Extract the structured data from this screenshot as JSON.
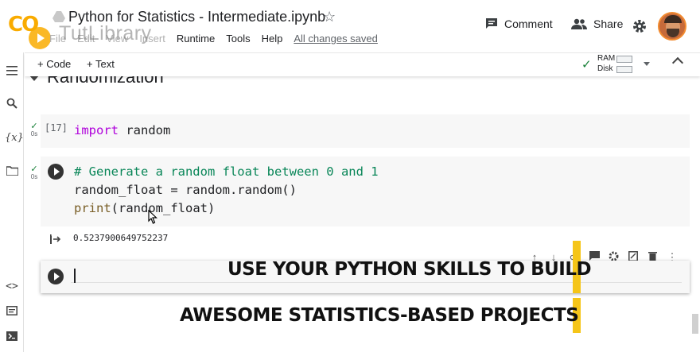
{
  "header": {
    "notebook_title": "Python for Statistics - Intermediate.ipynb",
    "watermark": "TutLibrary",
    "menu": [
      "File",
      "Edit",
      "View",
      "Insert",
      "Runtime",
      "Tools",
      "Help"
    ],
    "saved_status": "All changes saved",
    "comment_label": "Comment",
    "share_label": "Share"
  },
  "toolbar": {
    "add_code_label": "+ Code",
    "add_text_label": "+ Text",
    "ram_label": "RAM",
    "disk_label": "Disk"
  },
  "section": {
    "heading": "Randomization"
  },
  "cells": [
    {
      "exec_count": "[17]",
      "status_time": "0s",
      "code_line1_kw": "import",
      "code_line1_rest": " random"
    },
    {
      "status_time": "0s",
      "comment": "# Generate a random float between 0 and 1",
      "line2_a": "random_float = random.random()",
      "line3_fn": "print",
      "line3_rest": "(random_float)",
      "output": "0.5237900649752237"
    }
  ],
  "overlay": {
    "line1": "USE YOUR PYTHON SKILLS TO BUILD",
    "line2": "AWESOME STATISTICS-BASED PROJECTS",
    "accent_color": "#f5c518"
  },
  "colors": {
    "success": "#188038",
    "keyword": "#af00db",
    "comment": "#098658",
    "function": "#795e26"
  }
}
